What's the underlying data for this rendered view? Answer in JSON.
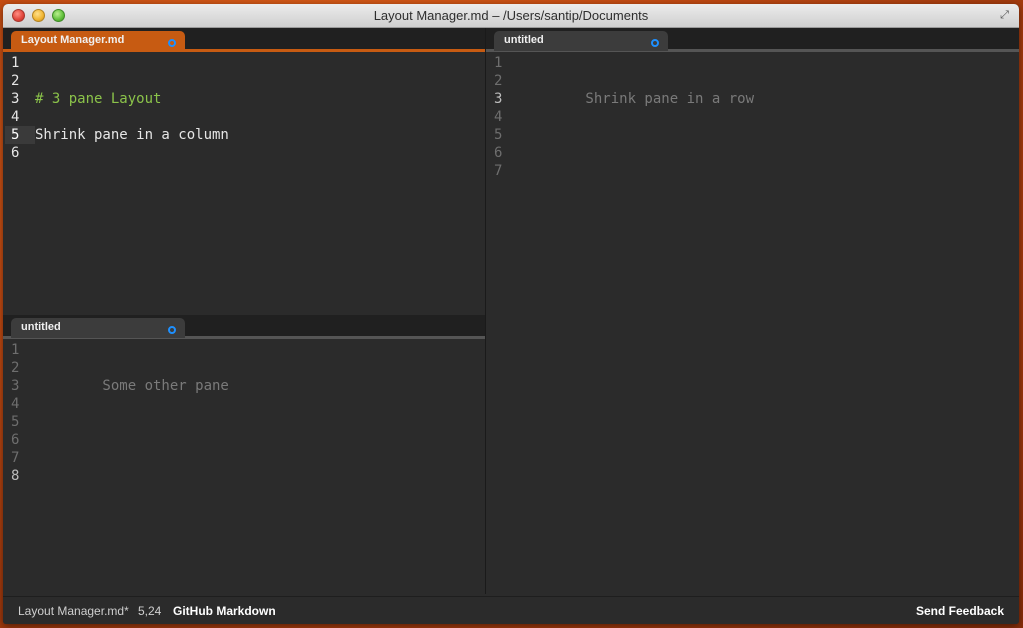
{
  "window": {
    "title": "Layout Manager.md – /Users/santip/Documents"
  },
  "colors": {
    "accent_tab": "#c75b12",
    "inactive_tab": "#3c3c3c",
    "dirty_dot": "#1e90ff",
    "heading_text": "#8bc34a",
    "code_text": "#e6e6e6",
    "dim_text": "#7a7a7a"
  },
  "panes": {
    "top_left": {
      "tab_label": "Layout Manager.md",
      "lines": [
        "1",
        "2",
        "3",
        "4",
        "5",
        "6"
      ],
      "code": {
        "line3": "# 3 pane Layout",
        "line5": "Shrink pane in a column"
      }
    },
    "right": {
      "tab_label": "untitled",
      "lines": [
        "1",
        "2",
        "3",
        "4",
        "5",
        "6",
        "7"
      ],
      "code": {
        "line3": "        Shrink pane in a row"
      }
    },
    "bottom_left": {
      "tab_label": "untitled",
      "lines": [
        "1",
        "2",
        "3",
        "4",
        "5",
        "6",
        "7",
        "8"
      ],
      "code": {
        "line3": "        Some other pane"
      }
    }
  },
  "status": {
    "file": "Layout Manager.md*",
    "cursor": "5,24",
    "syntax": "GitHub Markdown",
    "feedback": "Send Feedback"
  },
  "icons": {
    "fullscreen": "fullscreen-icon",
    "dirty": "unsaved-dot-icon"
  }
}
